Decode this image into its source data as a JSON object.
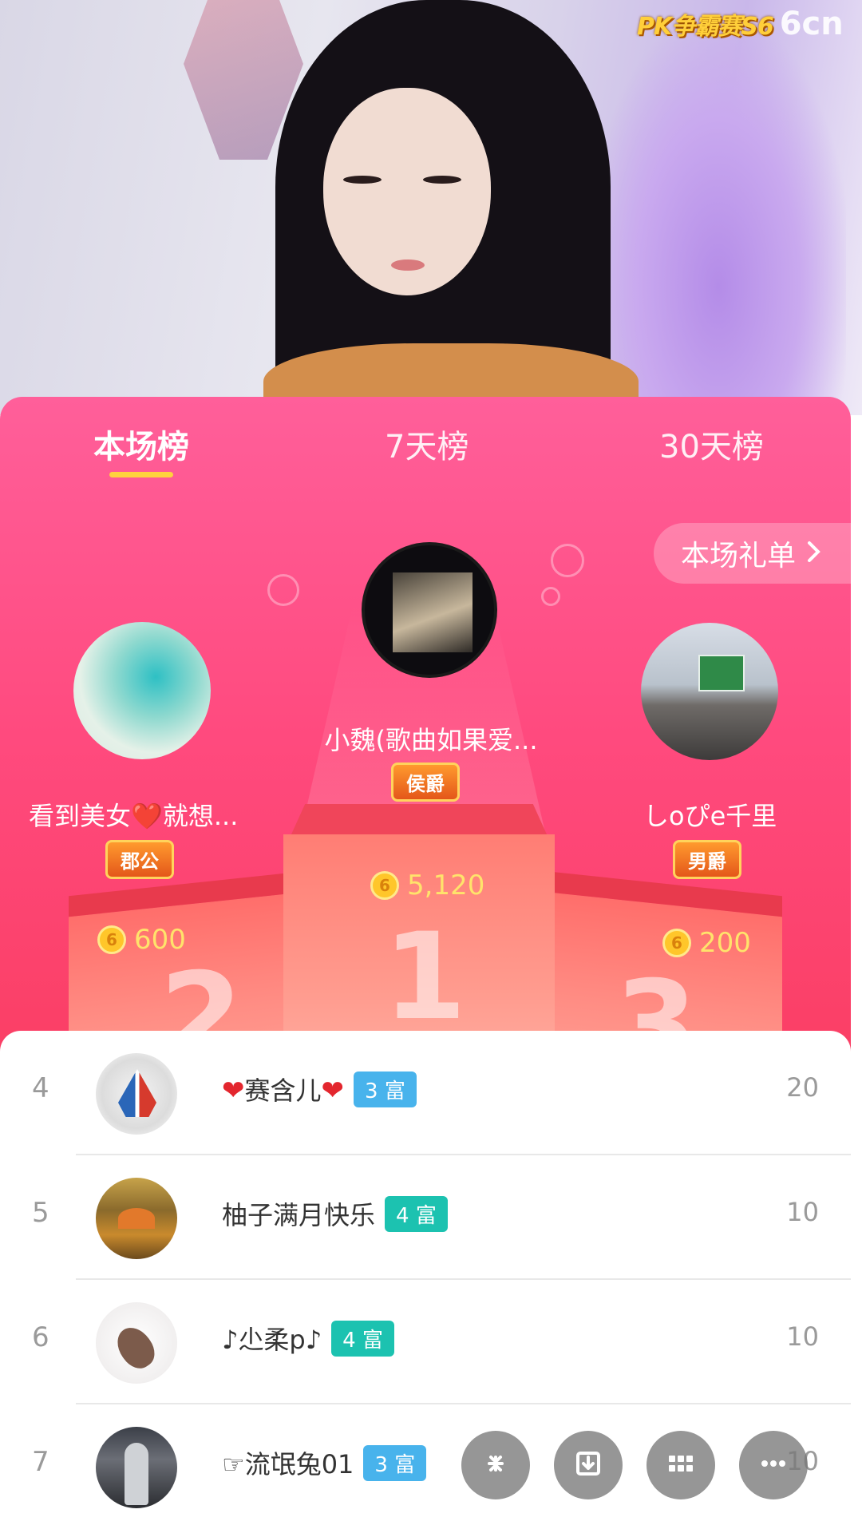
{
  "brand": {
    "show_logo": "PK争霸赛S6",
    "site_mark": "6cn"
  },
  "tabs": [
    {
      "label": "本场榜",
      "active": true
    },
    {
      "label": "7天榜",
      "active": false
    },
    {
      "label": "30天榜",
      "active": false
    }
  ],
  "gift_list_button": {
    "label": "本场礼单",
    "icon": "chevron-right-icon"
  },
  "top3": {
    "first": {
      "name": "小魏(歌曲如果爱...",
      "badge": "侯爵",
      "coins": "5,120",
      "podium": "1"
    },
    "second": {
      "name": "看到美女❤️就想...",
      "badge": "郡公",
      "coins": "600",
      "podium": "2"
    },
    "third": {
      "name": "しoぴe千里",
      "badge": "男爵",
      "coins": "200",
      "podium": "3"
    }
  },
  "coin_glyph": "6",
  "list": [
    {
      "rank": "4",
      "heart_left": "❤",
      "name": "赛含儿",
      "heart_right": "❤",
      "level": "3 富",
      "score": "20"
    },
    {
      "rank": "5",
      "name": "柚子满月快乐",
      "level": "4 富",
      "score": "10"
    },
    {
      "rank": "6",
      "name": "♪尐柔p♪",
      "level": "4 富",
      "score": "10"
    },
    {
      "rank": "7",
      "name": "☞流氓兔01",
      "level": "3 富",
      "score": "10"
    }
  ],
  "fabs": [
    "sparkle-icon",
    "download-icon",
    "grid-icon",
    "more-icon"
  ],
  "colors": {
    "panel_top": "#ff5f9a",
    "panel_bottom": "#ef3752",
    "tab_underline": "#ffd23e",
    "coin": "#ffc62a",
    "level3": "#48b3ec",
    "level4": "#1cc2b0"
  }
}
